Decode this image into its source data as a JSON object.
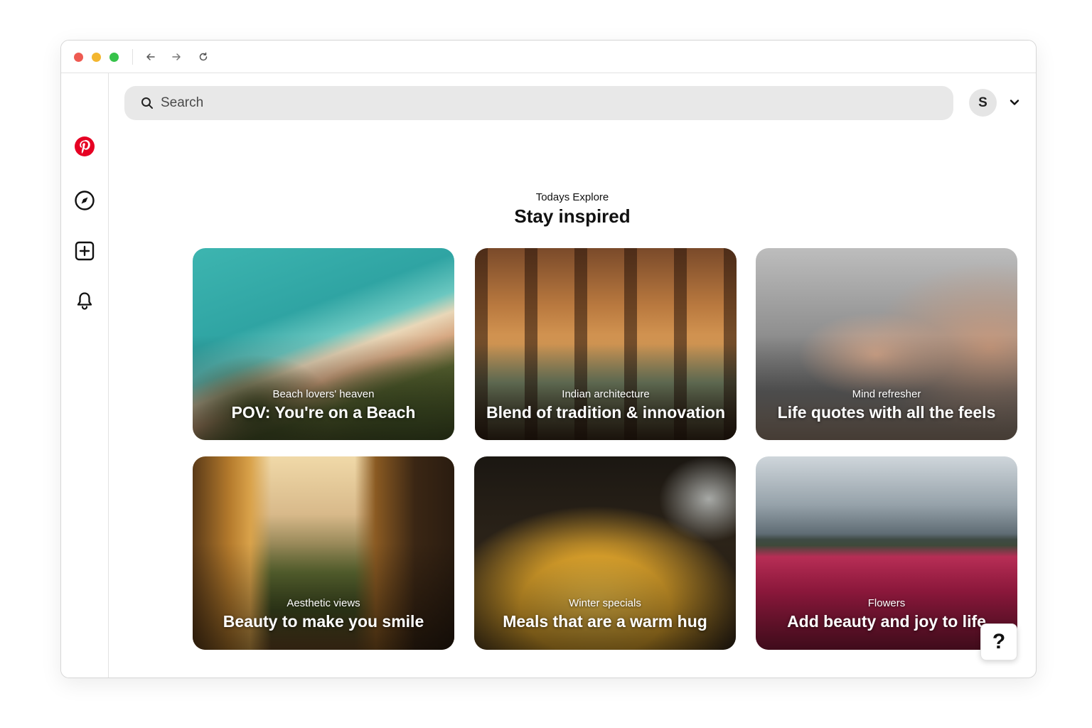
{
  "chrome": {
    "buttons": [
      "close",
      "minimize",
      "maximize"
    ],
    "nav_icons": [
      "arrow-left-icon",
      "arrow-right-icon",
      "reload-icon"
    ]
  },
  "sidebar": {
    "items": [
      {
        "icon": "pinterest-logo",
        "color": "#e60023"
      },
      {
        "icon": "compass-icon"
      },
      {
        "icon": "plus-square-icon"
      },
      {
        "icon": "bell-icon"
      }
    ],
    "footer_icon": "settings-icon"
  },
  "search": {
    "placeholder": "Search"
  },
  "profile": {
    "initial": "S"
  },
  "explore": {
    "subtitle": "Todays Explore",
    "title": "Stay inspired"
  },
  "cards": [
    {
      "category": "Beach lovers' heaven",
      "headline": "POV: You're on a Beach"
    },
    {
      "category": "Indian architecture",
      "headline": "Blend of tradition & innovation"
    },
    {
      "category": "Mind refresher",
      "headline": "Life quotes with all the feels"
    },
    {
      "category": "Aesthetic views",
      "headline": "Beauty to make you smile"
    },
    {
      "category": "Winter specials",
      "headline": "Meals that are a warm hug"
    },
    {
      "category": "Flowers",
      "headline": "Add beauty and joy to life"
    }
  ],
  "help": {
    "label": "?"
  },
  "colors": {
    "brand": "#e60023",
    "search_bg": "#e8e8e8",
    "traffic_red": "#ee5a52",
    "traffic_yellow": "#f3b62f",
    "traffic_green": "#36c24a"
  }
}
